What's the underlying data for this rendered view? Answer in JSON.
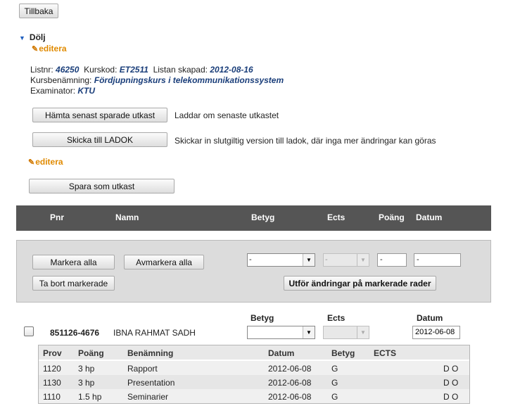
{
  "top": {
    "back_label": "Tillbaka"
  },
  "toggle": {
    "label": "Dölj"
  },
  "edit_label": "editera",
  "info": {
    "listnr_label": "Listnr:",
    "listnr": "46250",
    "kurskod_label": "Kurskod:",
    "kurskod": "ET2511",
    "skapad_label": "Listan skapad:",
    "skapad": "2012-08-16",
    "kursbenamning_label": "Kursbenämning:",
    "kursbenamning": "Fördjupningskurs i telekommunikationssystem",
    "examinator_label": "Examinator:",
    "examinator": "KTU"
  },
  "actions": {
    "hamta_label": "Hämta senast sparade utkast",
    "hamta_desc": "Laddar om senaste utkastet",
    "skicka_label": "Skicka till LADOK",
    "skicka_desc": "Skickar in slutgiltig version till ladok, där inga mer ändringar kan göras",
    "spara_label": "Spara som utkast"
  },
  "table_header": {
    "pnr": "Pnr",
    "namn": "Namn",
    "betyg": "Betyg",
    "ects": "Ects",
    "poang": "Poäng",
    "datum": "Datum"
  },
  "bulk": {
    "markera_alla": "Markera alla",
    "avmarkera_alla": "Avmarkera alla",
    "ta_bort": "Ta bort markerade",
    "utfor": "Utför ändringar på markerade rader",
    "betyg_value": "-",
    "ects_value": "-",
    "poang_value": "-",
    "datum_value": "-"
  },
  "student_labels": {
    "betyg": "Betyg",
    "ects": "Ects",
    "datum": "Datum"
  },
  "student": {
    "pnr": "851126-4676",
    "name": "IBNA RAHMAT SADH",
    "betyg_value": "",
    "ects_value": "",
    "datum_value": "2012-06-08"
  },
  "subtable": {
    "headers": {
      "prov": "Prov",
      "poang": "Poäng",
      "benamning": "Benämning",
      "datum": "Datum",
      "betyg": "Betyg",
      "ects": "ECTS"
    },
    "rows": [
      {
        "prov": "1120",
        "poang": "3 hp",
        "benamning": "Rapport",
        "datum": "2012-06-08",
        "betyg": "G",
        "ects": "",
        "flags": "D O"
      },
      {
        "prov": "1130",
        "poang": "3 hp",
        "benamning": "Presentation",
        "datum": "2012-06-08",
        "betyg": "G",
        "ects": "",
        "flags": "D O"
      },
      {
        "prov": "1110",
        "poang": "1.5 hp",
        "benamning": "Seminarier",
        "datum": "2012-06-08",
        "betyg": "G",
        "ects": "",
        "flags": "D O"
      }
    ]
  },
  "colors": {
    "header_bg": "#555555",
    "link_orange": "#e08a00",
    "value_blue": "#1a3e7a",
    "toggle_blue": "#1f5fbf"
  }
}
